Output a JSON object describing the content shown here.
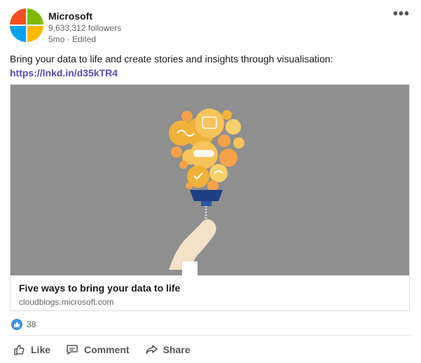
{
  "post": {
    "author": {
      "name": "Microsoft",
      "followers": "9,633,312 followers",
      "meta": "5mo · Edited"
    },
    "more_label": "•••",
    "text": "Bring your data to life and create stories and insights through visualisation:",
    "link": "https://lnkd.in/d35kTR4"
  },
  "card": {
    "title": "Five ways to bring your data to life",
    "domain": "cloudblogs.microsoft.com"
  },
  "reactions": {
    "count": "38",
    "icon": "thumbs-up-icon"
  },
  "actions": [
    {
      "label": "Like",
      "icon": "thumbs-up-outline-icon"
    },
    {
      "label": "Comment",
      "icon": "comment-icon"
    },
    {
      "label": "Share",
      "icon": "share-icon"
    }
  ],
  "colors": {
    "link": "#5b49b8",
    "ms_red": "#f25022",
    "ms_green": "#7fba00",
    "ms_blue": "#00a4ef",
    "ms_yellow": "#ffb900",
    "like_blue": "#378fe9"
  }
}
